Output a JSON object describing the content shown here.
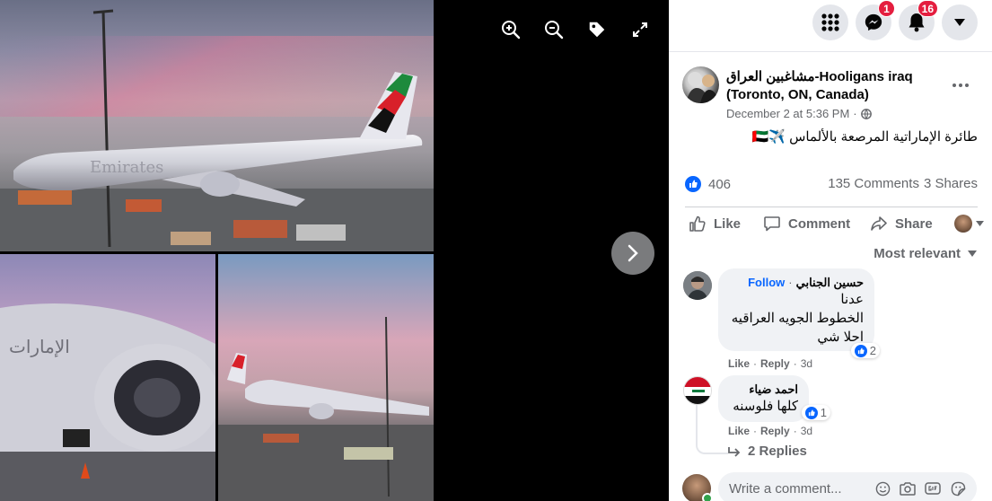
{
  "colors": {
    "accent": "#0866ff",
    "badge": "#e41e3f",
    "muted": "#65676b",
    "bubble": "#f0f2f5",
    "online": "#31a24c"
  },
  "viewer": {
    "photo_texts": {
      "livery_a": "Emirates",
      "livery_b": "الإمارات"
    },
    "tools": [
      {
        "name": "zoom-in-icon"
      },
      {
        "name": "zoom-out-icon"
      },
      {
        "name": "tag-icon"
      },
      {
        "name": "fullscreen-icon"
      }
    ],
    "next_icon": "chevron-right-icon"
  },
  "nav": {
    "menu_icon": "grid-menu-icon",
    "messenger_badge": "1",
    "notifications_badge": "16",
    "account_icon": "caret-down-icon"
  },
  "post": {
    "author": "مشاغبين العراق-Hooligans iraq (Toronto, ON, Canada)",
    "time": "December 2 at 5:36 PM",
    "separator": "·",
    "privacy_icon": "globe-icon",
    "text": "طائرة الإماراتية المرصعة بالألماس ✈️🇦🇪",
    "likes": "406",
    "comments": "135 Comments",
    "shares": "3 Shares",
    "actions": {
      "like": "Like",
      "comment": "Comment",
      "share": "Share"
    },
    "sort": "Most relevant"
  },
  "comments": [
    {
      "name": "حسين الجنابي",
      "follow": "Follow",
      "dot": "·",
      "lines": [
        "عدنا",
        "الخطوط الجويه العراقيه",
        "احلا شي"
      ],
      "reactions": "2",
      "like": "Like",
      "reply": "Reply",
      "age": "3d"
    },
    {
      "name": "احمد ضياء",
      "lines": [
        "كلها فلوسنه"
      ],
      "reactions": "1",
      "like": "Like",
      "reply": "Reply",
      "age": "3d"
    }
  ],
  "replies": "2 Replies",
  "write_comment": {
    "placeholder": "Write a comment..."
  }
}
